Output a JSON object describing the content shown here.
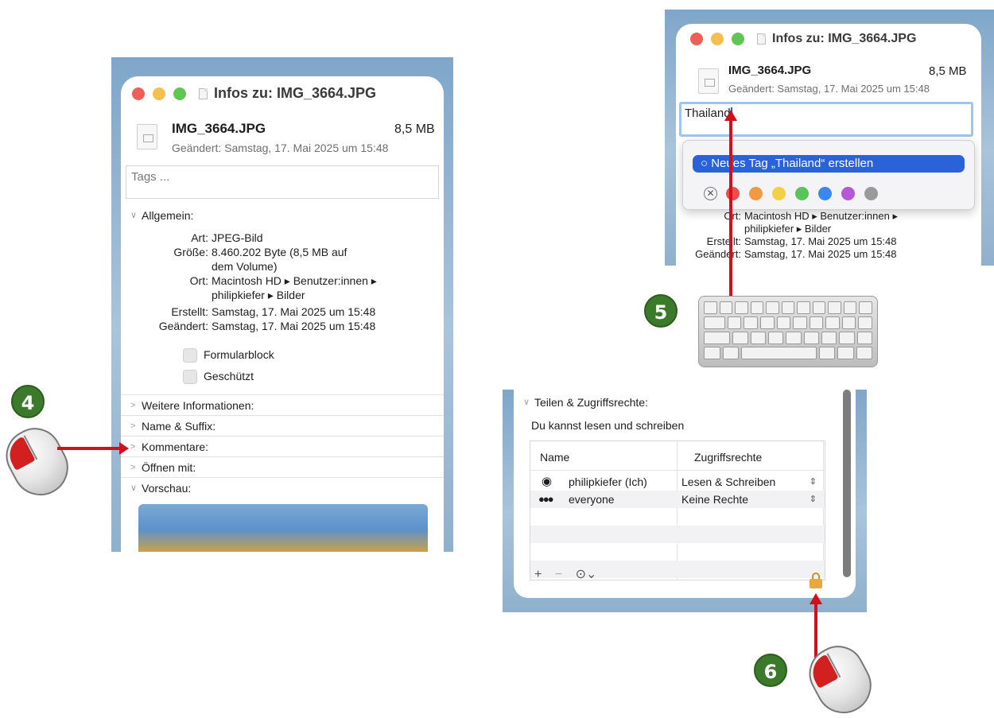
{
  "window_left": {
    "title": "Infos zu: IMG_3664.JPG",
    "file_name": "IMG_3664.JPG",
    "file_size": "8,5 MB",
    "modified_line": "Geändert: Samstag, 17. Mai 2025 um 15:48",
    "tags_placeholder": "Tags ...",
    "sections": {
      "general": "Allgemein:",
      "more_info": "Weitere Informationen:",
      "name_ext": "Name & Suffix:",
      "comments": "Kommentare:",
      "open_with": "Öffnen mit:",
      "preview": "Vorschau:"
    },
    "info": {
      "kind_k": "Art:",
      "kind_v": "JPEG-Bild",
      "size_k": "Größe:",
      "size_v": "8.460.202 Byte (8,5 MB auf dem Volume)",
      "where_k": "Ort:",
      "where_v": "Macintosh HD ▸ Benutzer:innen ▸ philipkiefer ▸ Bilder",
      "created_k": "Erstellt:",
      "created_v": "Samstag, 17. Mai 2025 um 15:48",
      "modified_k": "Geändert:",
      "modified_v": "Samstag, 17. Mai 2025 um 15:48"
    },
    "checkboxes": {
      "stationery": "Formularblock",
      "locked": "Geschützt"
    }
  },
  "window_top_right": {
    "title": "Infos zu: IMG_3664.JPG",
    "file_name": "IMG_3664.JPG",
    "file_size": "8,5 MB",
    "modified_line": "Geändert: Samstag, 17. Mai 2025 um 15:48",
    "tag_input_value": "Thailand",
    "new_tag_option": "○ Neues Tag „Thailand“ erstellen",
    "tag_colors": [
      "#ee4b4b",
      "#f19a46",
      "#f4cf48",
      "#5ac45a",
      "#3b87f0",
      "#b458d6",
      "#9a9a9a"
    ],
    "info_partial": {
      "where_k": "Ort:",
      "where_v1": "Macintosh HD ▸ Benutzer:innen ▸",
      "where_v2": "philipkiefer ▸ Bilder",
      "created_k": "Erstellt:",
      "created_v": "Samstag, 17. Mai 2025 um 15:48",
      "modified_k": "Geändert:",
      "modified_v": "Samstag, 17. Mai 2025 um 15:48"
    }
  },
  "window_bottom_right": {
    "section": "Teilen & Zugriffsrechte:",
    "status": "Du kannst lesen und schreiben",
    "col_name": "Name",
    "col_rights": "Zugriffsrechte",
    "rows": [
      {
        "name": "philipkiefer (Ich)",
        "rights": "Lesen & Schreiben"
      },
      {
        "name": "everyone",
        "rights": "Keine Rechte"
      }
    ],
    "toolbar": {
      "add": "+",
      "remove": "−",
      "more": "⊙⌄"
    }
  },
  "steps": {
    "four": "4",
    "five": "5",
    "six": "6"
  }
}
